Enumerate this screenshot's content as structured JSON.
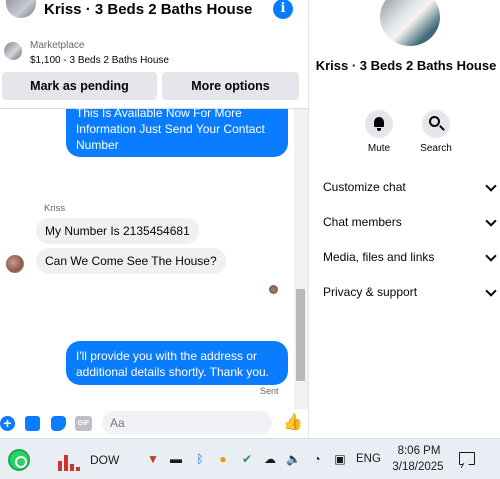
{
  "chat": {
    "title": "Kriss · 3 Beds 2 Baths House",
    "listing": {
      "kind": "Marketplace",
      "price_title": "$1,100 - 3 Beds 2 Baths House"
    },
    "actions": {
      "pending": "Mark as pending",
      "more": "More options"
    },
    "messages": {
      "outgoing_1": "This Is Available Now For More Information Just Send Your Contact Number",
      "sender_name": "Kriss",
      "incoming_1": "My Number Is 2135454681",
      "incoming_2": "Can We Come See The House?",
      "outgoing_2": "I'll provide you with the address or additional details shortly. Thank you.",
      "status": "Sent"
    },
    "composer": {
      "placeholder": "Aa",
      "gif_label": "GIF"
    }
  },
  "details": {
    "title": "Kriss · 3 Beds 2 Baths House",
    "mute_label": "Mute",
    "search_label": "Search",
    "sections": [
      "Customize chat",
      "Chat members",
      "Media, files and links",
      "Privacy & support"
    ]
  },
  "taskbar": {
    "app_label": "DOW",
    "language": "ENG",
    "time": "8:06 PM",
    "date": "3/18/2025"
  },
  "colors": {
    "messenger_blue": "#0a7cff",
    "incoming_bubble": "#f0f0f0",
    "button_gray": "#e4e6eb",
    "taskbar": "#e9eef5"
  }
}
